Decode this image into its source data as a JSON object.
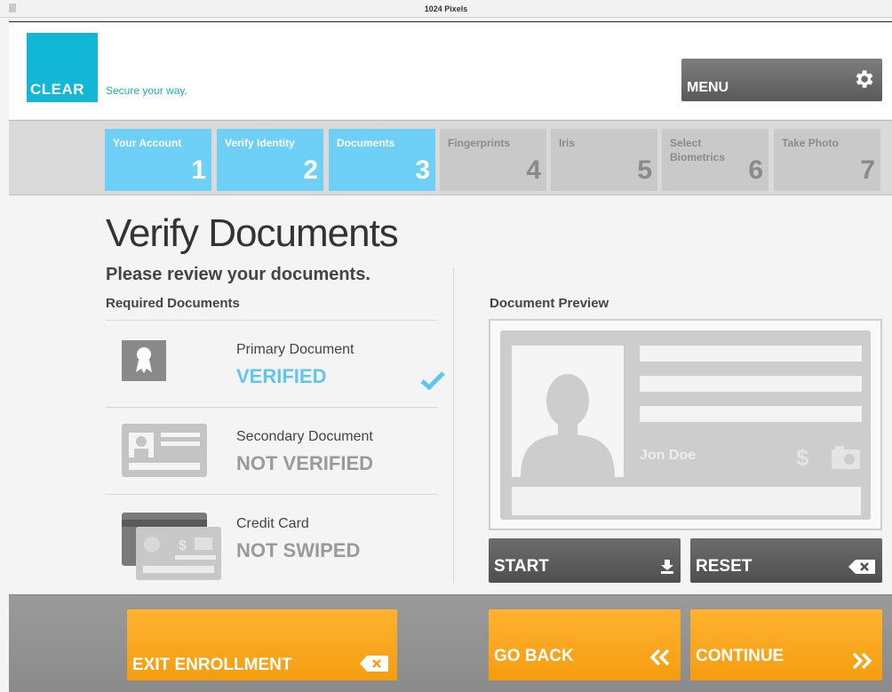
{
  "ruler": {
    "label": "1024 Pixels"
  },
  "header": {
    "logo_text": "CLEAR",
    "tagline": "Secure your way.",
    "menu_label": "MENU"
  },
  "steps": [
    {
      "label": "Your Account",
      "number": "1",
      "active": true
    },
    {
      "label": "Verify Identity",
      "number": "2",
      "active": true
    },
    {
      "label": "Documents",
      "number": "3",
      "active": true
    },
    {
      "label": "Fingerprints",
      "number": "4",
      "active": false
    },
    {
      "label": "Iris",
      "number": "5",
      "active": false
    },
    {
      "label": "Select Biometrics",
      "number": "6",
      "active": false
    },
    {
      "label": "Take Photo",
      "number": "7",
      "active": false
    }
  ],
  "main": {
    "title": "Verify Documents",
    "subtitle": "Please review your documents.",
    "required_heading": "Required Documents",
    "preview_heading": "Document Preview",
    "documents": [
      {
        "name": "Primary Document",
        "status": "VERIFIED",
        "icon": "award-ribbon-icon"
      },
      {
        "name": "Secondary Document",
        "status": "NOT VERIFIED",
        "icon": "id-card-icon"
      },
      {
        "name": "Credit Card",
        "status": "NOT SWIPED",
        "icon": "credit-card-icon"
      }
    ],
    "preview_card": {
      "name": "Jon Doe"
    },
    "start_label": "START",
    "reset_label": "RESET"
  },
  "footer": {
    "exit_label": "EXIT ENROLLMENT",
    "back_label": "GO BACK",
    "continue_label": "CONTINUE"
  },
  "colors": {
    "brand": "#12b6d6",
    "step_active": "#6ed0f6",
    "step_inactive": "#c9c9c9",
    "verified": "#5ec6ef",
    "orange": "#f7a21b",
    "dark_button": "#5a5a5a"
  }
}
